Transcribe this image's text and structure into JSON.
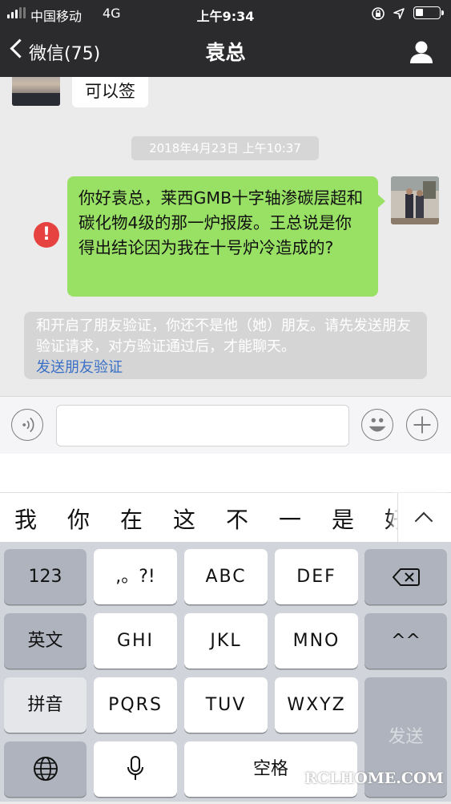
{
  "status_bar": {
    "carrier": "中国移动",
    "network": "4G",
    "time": "上午9:34",
    "icons": [
      "signal-icon",
      "orientation-lock-icon",
      "location-icon",
      "battery-icon"
    ]
  },
  "nav": {
    "back_label": "微信(75)",
    "title": "袁总",
    "right_icon": "profile-icon"
  },
  "chat": {
    "messages": [
      {
        "sender": "other",
        "text": "可以签"
      },
      {
        "type": "timestamp",
        "text": "2018年4月23日 上午10:37"
      },
      {
        "sender": "me",
        "status": "failed",
        "text": "你好袁总，莱西GMB十字轴渗碳层超和碳化物4级的那一炉报废。王总说是你得出结论因为我在十号炉冷造成的?"
      }
    ],
    "system_notice": {
      "text": "和开启了朋友验证，你还不是他（她）朋友。请先发送朋友验证请求，对方验证通过后，才能聊天。",
      "link": "发送朋友验证"
    }
  },
  "input_bar": {
    "voice_icon": "voice-icon",
    "text_value": "",
    "emoji_icon": "emoji-icon",
    "plus_icon": "plus-icon"
  },
  "candidates": [
    "我",
    "你",
    "在",
    "这",
    "不",
    "一",
    "是",
    "好"
  ],
  "keyboard": {
    "row1": [
      "123",
      ",。?!",
      "ABC",
      "DEF"
    ],
    "row2": [
      "英文",
      "GHI",
      "JKL",
      "MNO",
      "^^"
    ],
    "row3": [
      "拼音",
      "PQRS",
      "TUV",
      "WXYZ"
    ],
    "row4": [
      "空格"
    ],
    "send": "发送"
  },
  "watermark": "RCLHOME.COM",
  "colors": {
    "nav_bg": "#2b2b2d",
    "my_bubble": "#98e165",
    "error": "#e64340",
    "link": "#3a70c6"
  }
}
